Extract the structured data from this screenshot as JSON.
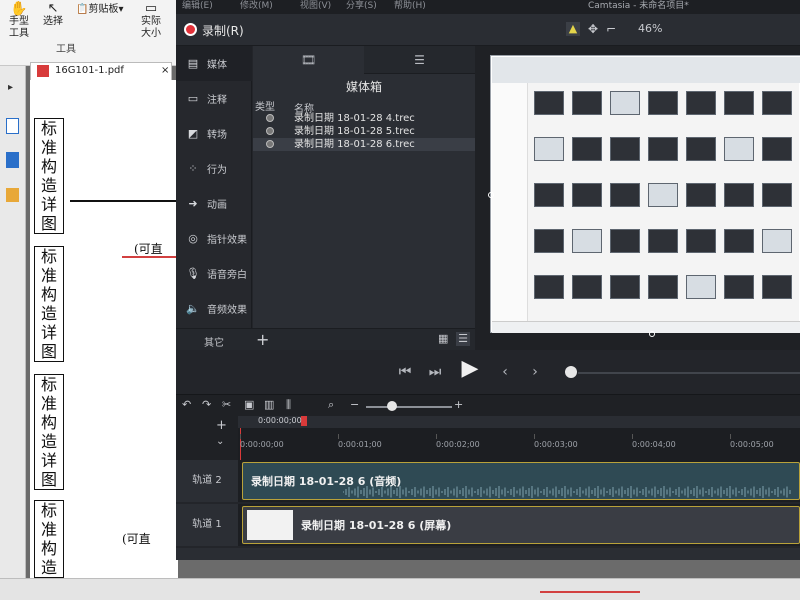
{
  "pdf": {
    "ribbon": {
      "hand_tool": "手型\n工具",
      "select": "选择",
      "clipboard": "剪贴板",
      "actual_size": "实际\n大小",
      "group_tools": "工具"
    },
    "tab_label": "16G101-1.pdf",
    "column_text": [
      "标",
      "准",
      "构",
      "造",
      "详",
      "图"
    ],
    "annotation": "(可直",
    "annotation_bottom": "(可直"
  },
  "camtasia": {
    "menu": [
      "编辑(E)",
      "修改(M)",
      "视图(V)",
      "分享(S)",
      "帮助(H)"
    ],
    "window_title": "Camtasia - 未命名项目*",
    "record_label": "录制(R)",
    "zoom_value": "46%",
    "sidebar": [
      {
        "icon": "media-icon",
        "label": "媒体"
      },
      {
        "icon": "annotation-icon",
        "label": "注释"
      },
      {
        "icon": "transition-icon",
        "label": "转场"
      },
      {
        "icon": "behavior-icon",
        "label": "行为"
      },
      {
        "icon": "animation-icon",
        "label": "动画"
      },
      {
        "icon": "cursor-effect-icon",
        "label": "指针效果"
      },
      {
        "icon": "voice-narration-icon",
        "label": "语音旁白"
      },
      {
        "icon": "audio-effect-icon",
        "label": "音频效果"
      }
    ],
    "sidebar_other": "其它",
    "bin": {
      "title": "媒体箱",
      "col_type": "类型",
      "col_name": "名称",
      "items": [
        "录制日期 18-01-28 4.trec",
        "录制日期 18-01-28 5.trec",
        "录制日期 18-01-28 6.trec"
      ]
    },
    "timeline": {
      "playhead_time": "0:00:00;00",
      "ticks": [
        "0:00:00;00",
        "0:00:01;00",
        "0:00:02;00",
        "0:00:03;00",
        "0:00:04;00",
        "0:00:05;00"
      ],
      "tracks": [
        {
          "label": "轨道 2",
          "clip": "录制日期 18-01-28 6 (音频)"
        },
        {
          "label": "轨道 1",
          "clip": "录制日期 18-01-28 6 (屏幕)"
        }
      ]
    }
  }
}
